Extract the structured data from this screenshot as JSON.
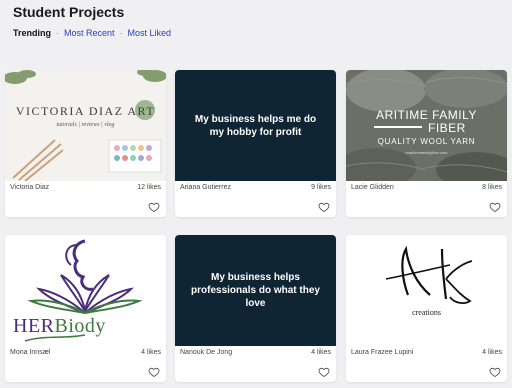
{
  "page": {
    "title": "Student Projects"
  },
  "filters": {
    "items": [
      {
        "label": "Trending",
        "state": "active"
      },
      {
        "label": "Most Recent",
        "state": "link"
      },
      {
        "label": "Most Liked",
        "state": "link"
      }
    ],
    "separator": "·"
  },
  "colors": {
    "link": "#2a3fbf",
    "dark_thumb": "#0f2533",
    "card_bg": "#ffffff",
    "page_bg": "#f0f0f2"
  },
  "projects": [
    {
      "author": "Victoria Diaz",
      "likes": "12 likes",
      "thumb": {
        "kind": "brand",
        "title": "VICTORIA DIAZ ART",
        "subtitle": "tutorials | reviews | vlog"
      }
    },
    {
      "author": "Ariana Gutierrez",
      "likes": "9 likes",
      "thumb": {
        "kind": "text",
        "text": "My business helps me do my hobby for profit"
      }
    },
    {
      "author": "Lacie Glidden",
      "likes": "8 likes",
      "thumb": {
        "kind": "yarn",
        "line1": "ARITIME FAMILY",
        "line2": "FIBER",
        "line3": "QUALITY WOOL YARN",
        "site": "maritimefamilyfiber.com"
      }
    },
    {
      "author": "Mona Innsæl",
      "likes": "4 likes",
      "thumb": {
        "kind": "logo",
        "her": "HER",
        "rest": "Biody"
      }
    },
    {
      "author": "Nanouk De Jong",
      "likes": "4 likes",
      "thumb": {
        "kind": "text",
        "text": "My business helps professionals do what they love"
      }
    },
    {
      "author": "Laura Frazee Lupini",
      "likes": "4 likes",
      "thumb": {
        "kind": "monogram",
        "text": "creations"
      }
    }
  ],
  "icons": {
    "like": "heart-icon"
  }
}
